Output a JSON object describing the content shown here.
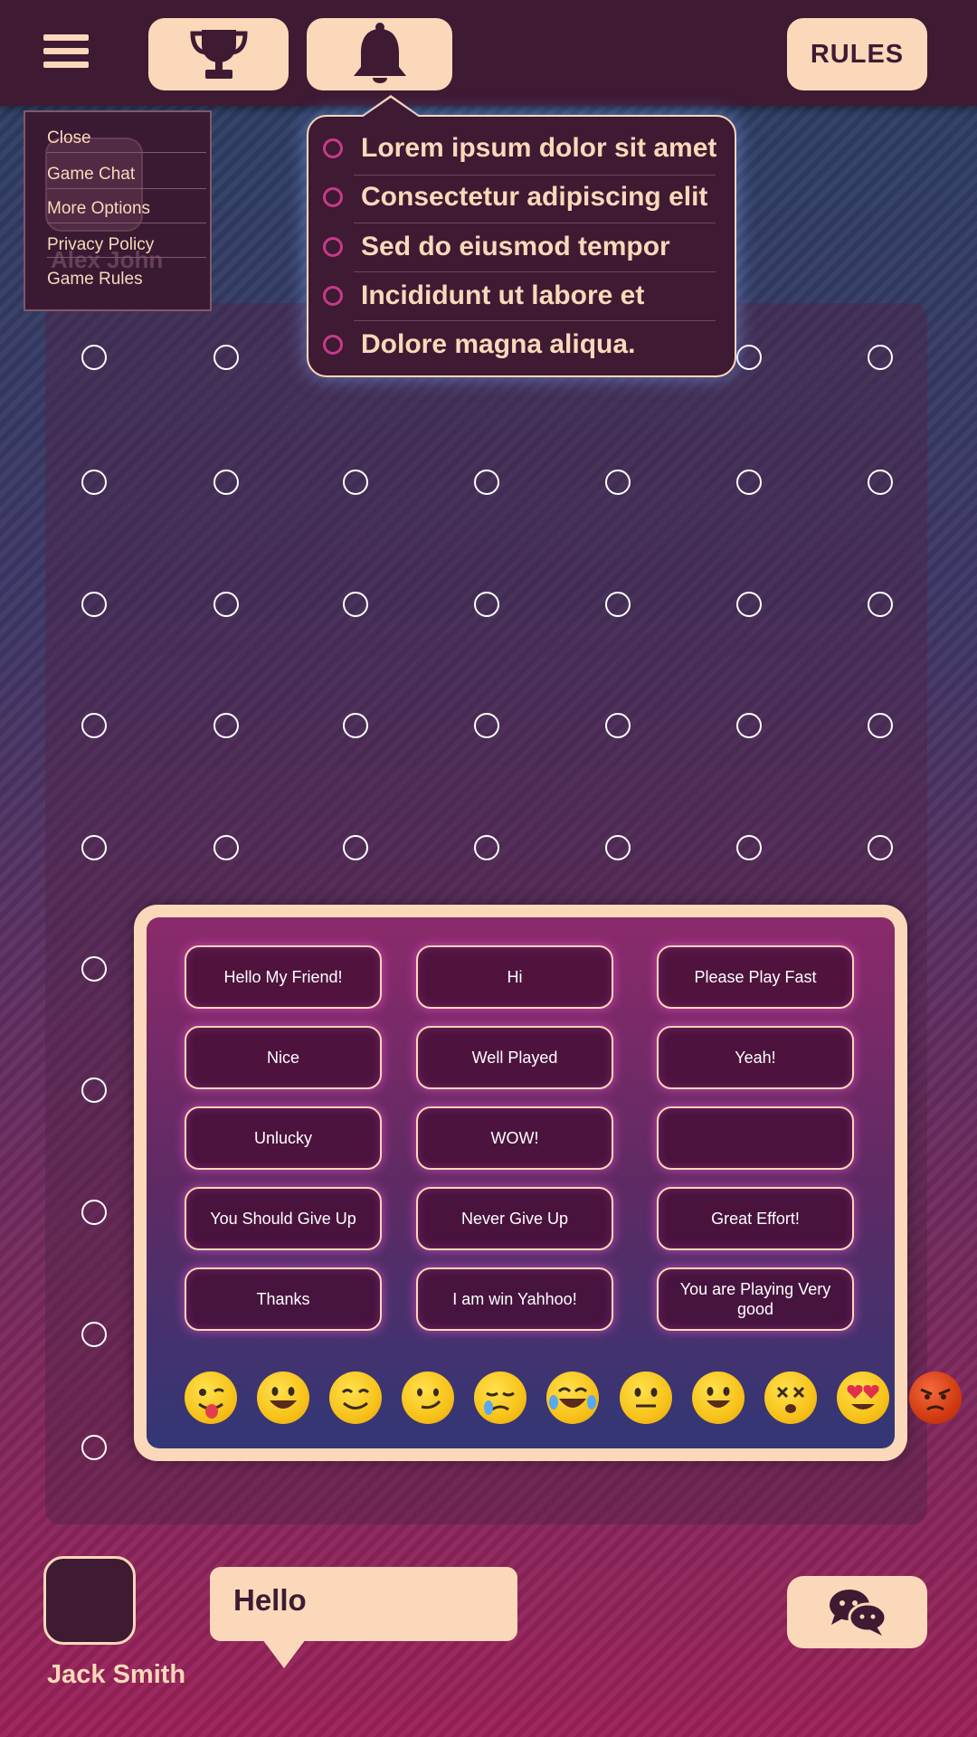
{
  "top_bar": {
    "menu_icon": "hamburger-icon",
    "trophy_icon": "trophy-icon",
    "bell_icon": "bell-icon",
    "rules_label": "RULES"
  },
  "menu": {
    "items": [
      "Close",
      "Game Chat",
      "More Options",
      "Privacy Policy",
      "Game Rules"
    ],
    "background_player_name": "Alex John"
  },
  "notifications": {
    "items": [
      "Lorem ipsum dolor sit amet",
      "Consectetur adipiscing elit",
      "Sed do eiusmod tempor",
      "Incididunt ut labore et",
      "Dolore magna aliqua."
    ]
  },
  "quick_chat": {
    "messages": [
      "Hello My Friend!",
      "Hi",
      "Please Play Fast",
      "Nice",
      "Well Played",
      "Yeah!",
      "Unlucky",
      "WOW!",
      "",
      "You Should Give Up",
      "Never Give Up",
      "Great Effort!",
      "Thanks",
      "I  am win Yahhoo!",
      "You are Playing Very good"
    ],
    "emojis": [
      "tongue-wink",
      "grin",
      "smile",
      "smirk",
      "sad-tear",
      "laugh-tears",
      "neutral",
      "happy",
      "dizzy",
      "heart-eyes",
      "angry"
    ]
  },
  "player": {
    "name": "Jack Smith",
    "speech_bubble": "Hello",
    "chat_icon": "chat-bubbles-icon"
  },
  "colors": {
    "accent_peach": "#fad8b9",
    "dark_plum": "#3e1a33",
    "glow_pink": "#e650c8"
  }
}
